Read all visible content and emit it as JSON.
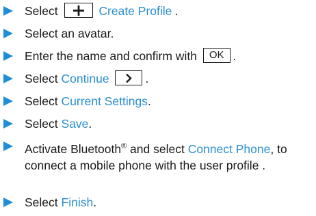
{
  "colors": {
    "bullet": "#1e8fd6",
    "link": "#2b8fd0",
    "text": "#1a1a1a"
  },
  "steps": [
    {
      "icon": "plus-icon",
      "pre": "Select",
      "link": "Create Profile",
      "post": "."
    },
    {
      "text": "Select an avatar."
    },
    {
      "pre": "Enter the name and confirm with",
      "key": "OK",
      "post": "."
    },
    {
      "pre": "Select",
      "link": "Continue",
      "icon": "chevron-right-icon",
      "post": "."
    },
    {
      "pre": "Select",
      "link": "Current Settings",
      "post": "."
    },
    {
      "pre": "Select",
      "link": "Save",
      "post": "."
    },
    {
      "pre": "Activate Bluetooth",
      "sup": "®",
      "mid": "and select",
      "link": "Connect Phone",
      "post": ", to connect a mobile phone with the user profile ."
    },
    {
      "pre": "Select",
      "link": "Finish",
      "post": "."
    }
  ]
}
